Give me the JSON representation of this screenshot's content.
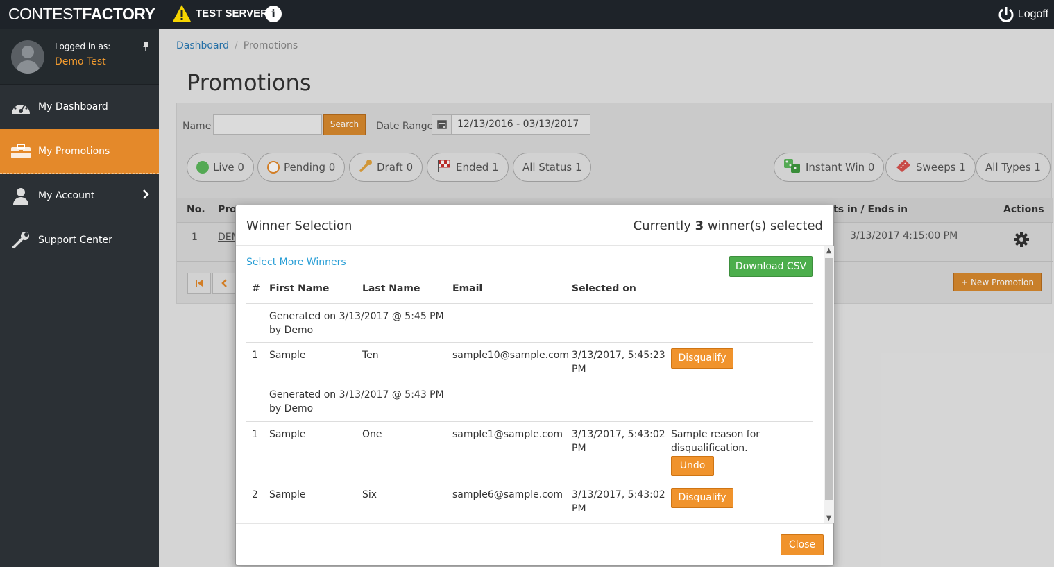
{
  "topbar": {
    "logo_light": "CONTEST",
    "logo_bold": "FACTORY",
    "server_label": "TEST SERVER",
    "info_glyph": "i",
    "logoff_label": "Logoff"
  },
  "sidebar": {
    "logged_in_label": "Logged in as:",
    "user_name": "Demo Test",
    "items": [
      {
        "label": "My Dashboard",
        "icon": "dashboard-icon"
      },
      {
        "label": "My Promotions",
        "icon": "briefcase-icon",
        "active": true
      },
      {
        "label": "My Account",
        "icon": "user-icon"
      },
      {
        "label": "Support Center",
        "icon": "wrench-icon"
      }
    ]
  },
  "breadcrumb": {
    "home": "Dashboard",
    "separator": "/",
    "current": "Promotions"
  },
  "page_title": "Promotions",
  "filters": {
    "name_label": "Name",
    "name_value": "",
    "search_label": "Search",
    "date_range_label": "Date Range",
    "date_range_value": "12/13/2016 - 03/13/2017",
    "status_pills": [
      {
        "label": "Live 0"
      },
      {
        "label": "Pending 0"
      },
      {
        "label": "Draft 0"
      },
      {
        "label": "Ended 1"
      },
      {
        "label": "All Status 1"
      }
    ],
    "type_pills": [
      {
        "label": "Instant Win 0"
      },
      {
        "label": "Sweeps 1"
      },
      {
        "label": "All Types 1"
      }
    ]
  },
  "promo_table": {
    "headers": {
      "no": "No.",
      "promo": "Pro",
      "starts": "ts in / Ends in",
      "actions": "Actions"
    },
    "row": {
      "no": "1",
      "promo": "DEM",
      "ends": "3/13/2017 4:15:00 PM"
    },
    "new_promotion_label": "New Promotion"
  },
  "modal": {
    "title": "Winner Selection",
    "status_prefix": "Currently ",
    "status_count": "3",
    "status_suffix": " winner(s) selected",
    "select_more_label": "Select More Winners",
    "download_csv_label": "Download CSV",
    "columns": {
      "num": "#",
      "first": "First Name",
      "last": "Last Name",
      "email": "Email",
      "selected": "Selected on"
    },
    "groups": [
      {
        "generated": "Generated on 3/13/2017 @ 5:45 PM",
        "by": "by Demo",
        "rows": [
          {
            "num": "1",
            "first": "Sample",
            "last": "Ten",
            "email": "sample10@sample.com",
            "selected_1": "3/13/2017, 5:45:23",
            "selected_2": "PM",
            "action": "Disqualify"
          }
        ]
      },
      {
        "generated": "Generated on 3/13/2017 @ 5:43 PM",
        "by": "by Demo",
        "rows": [
          {
            "num": "1",
            "first": "Sample",
            "last": "One",
            "email": "sample1@sample.com",
            "selected_1": "3/13/2017, 5:43:02",
            "selected_2": "PM",
            "reason_1": "Sample reason for",
            "reason_2": "disqualification.",
            "action": "Undo"
          },
          {
            "num": "2",
            "first": "Sample",
            "last": "Six",
            "email": "sample6@sample.com",
            "selected_1": "3/13/2017, 5:43:02",
            "selected_2": "PM",
            "action": "Disqualify"
          }
        ]
      }
    ],
    "close_label": "Close"
  },
  "colors": {
    "topbar": "#1e2329",
    "sidebar": "#2b3035",
    "accent_orange": "#e4892a",
    "csv_green": "#4cae4c",
    "link_blue": "#2a9fd6"
  }
}
